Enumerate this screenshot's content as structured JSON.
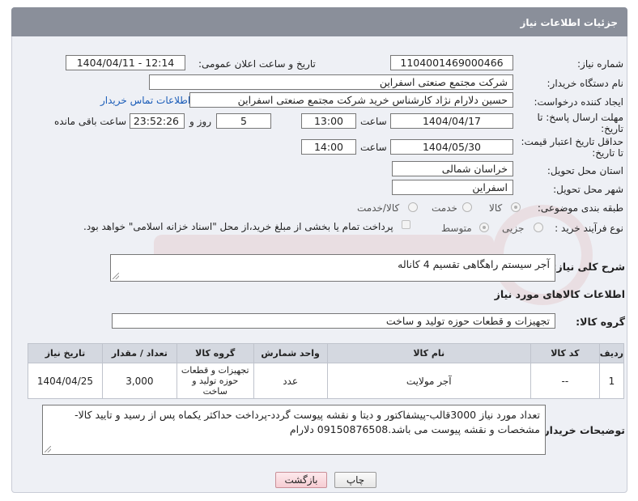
{
  "page": {
    "title": "جزئیات اطلاعات نیاز"
  },
  "fields": {
    "need_number_label": "شماره نیاز:",
    "need_number": "1104001469000466",
    "announce_label": "تاریخ و ساعت اعلان عمومی:",
    "announce_value": "1404/04/11 - 12:14",
    "buyer_label": "نام دستگاه خریدار:",
    "buyer_value": "شرکت مجتمع صنعتی اسفراین",
    "creator_label": "ایجاد کننده درخواست:",
    "creator_value": "حسین دلارام نژاد کارشناس خرید شرکت مجتمع صنعتی اسفراین",
    "contact_link": "اطلاعات تماس خریدار",
    "deadline_label_1": "مهلت ارسال پاسخ: تا",
    "deadline_label_2": "تاریخ:",
    "deadline_date": "1404/04/17",
    "time_label": "ساعت",
    "deadline_time": "13:00",
    "days_value": "5",
    "days_label": "روز و",
    "remaining_time": "23:52:26",
    "remaining_label": "ساعت باقی مانده",
    "validity_label_1": "حداقل تاریخ اعتبار قیمت:",
    "validity_label_2": "تا تاریخ:",
    "validity_date": "1404/05/30",
    "validity_time": "14:00",
    "province_label": "استان محل تحویل:",
    "province_value": "خراسان شمالی",
    "city_label": "شهر محل تحویل:",
    "city_value": "اسفراین",
    "category_label": "طبقه بندی موضوعی:",
    "category_options": [
      "کالا",
      "خدمت",
      "کالا/خدمت"
    ],
    "process_label": "نوع فرآیند خرید :",
    "process_options": [
      "جزیی",
      "متوسط"
    ],
    "payment_note": "پرداخت تمام یا بخشی از مبلغ خرید،از محل \"اسناد خزانه اسلامی\" خواهد بود.",
    "summary_label": "شرح کلی نیاز:",
    "summary_value": "آجر سیستم راهگاهی تقسیم 4 کاناله",
    "goods_section": "اطلاعات کالاهای مورد نیاز",
    "group_label": "گروه کالا:",
    "group_value": "تجهیزات و قطعات حوزه تولید و ساخت",
    "buyer_notes_label": "توضیحات خریدار:",
    "buyer_notes_value": "تعداد مورد نیاز 3000قالب-پیشفاکتور و دیتا و نقشه پیوست گردد-پرداخت حداکثر یکماه پس از رسید و تایید کالا-مشخصات و نقشه پیوست می باشد.09150876508 دلارام"
  },
  "table": {
    "headers": [
      "ردیف",
      "کد کالا",
      "نام کالا",
      "واحد شمارش",
      "گروه کالا",
      "تعداد / مقدار",
      "تاریخ نیاز"
    ],
    "rows": [
      [
        "1",
        "--",
        "آجر مولایت",
        "عدد",
        "تجهیزات و قطعات حوزه تولید و ساخت",
        "3,000",
        "1404/04/25"
      ]
    ]
  },
  "buttons": {
    "print": "چاپ",
    "back": "بازگشت"
  },
  "colors": {
    "titlebar": "#8a8f9a",
    "link": "#1a5cb8",
    "back_button": "#f6cdd3"
  }
}
